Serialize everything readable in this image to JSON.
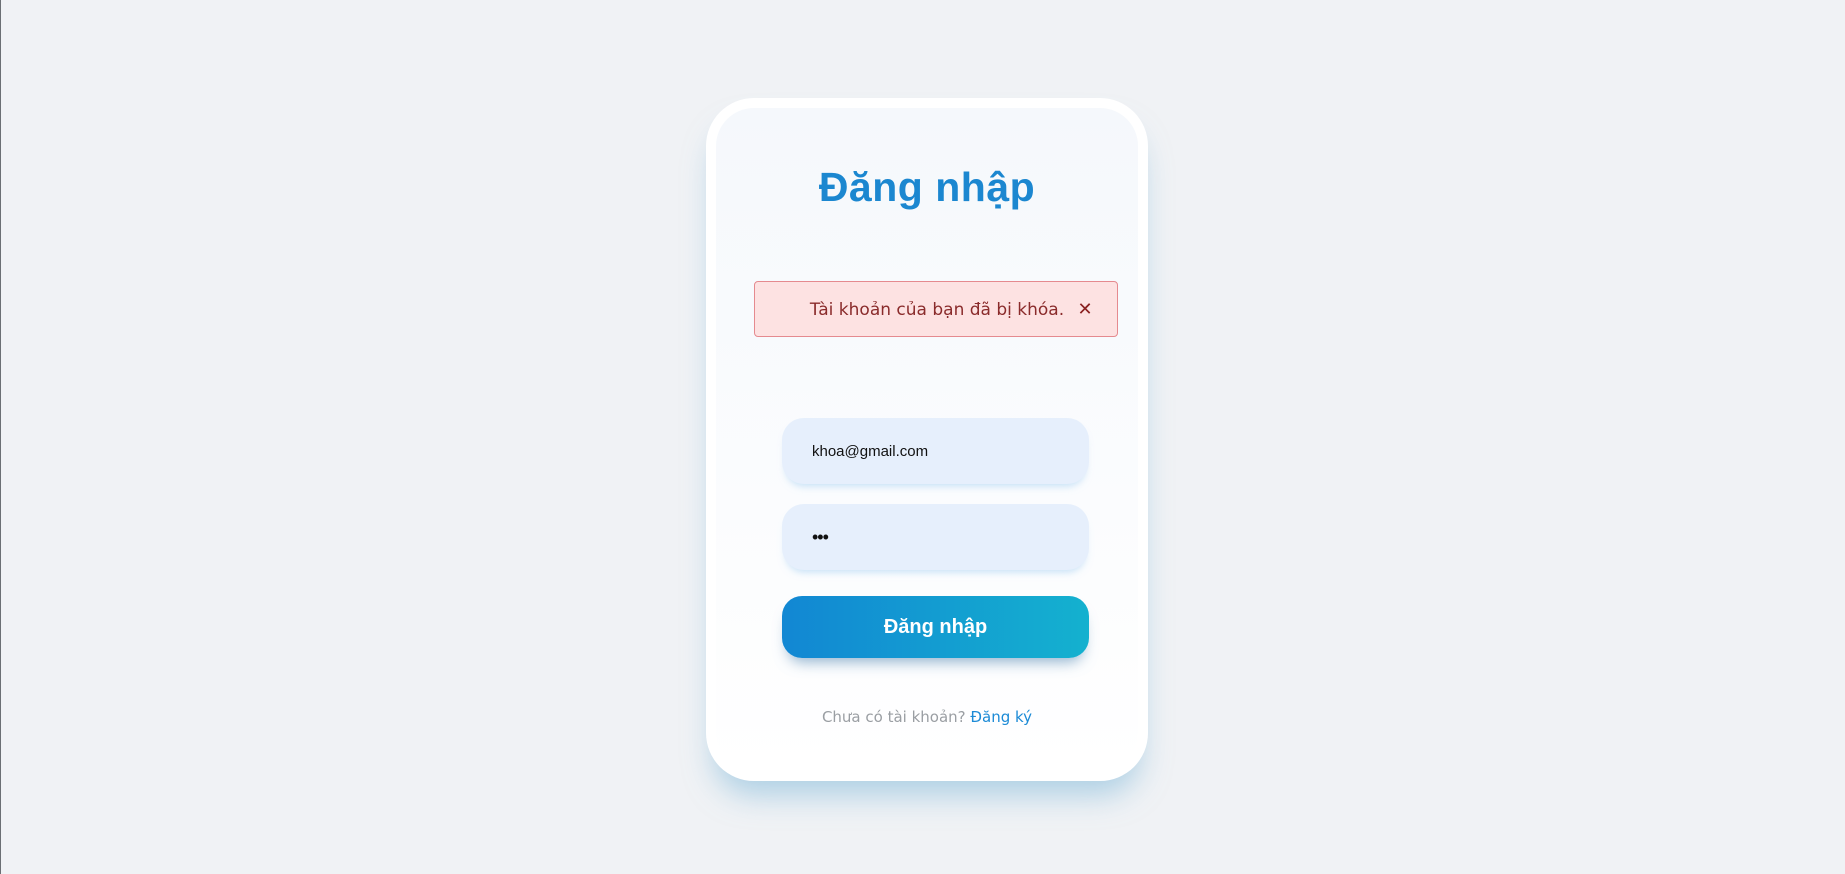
{
  "page": {
    "title": "Đăng nhập"
  },
  "alert": {
    "message": "Tài khoản của bạn đã bị khóa.",
    "close_glyph": "✕",
    "close_icon": "close-icon"
  },
  "form": {
    "email_value": "khoa@gmail.com",
    "password_value": "abc",
    "submit_label": "Đăng nhập"
  },
  "footer": {
    "prompt": "Chưa có tài khoản?",
    "signup_label": "Đăng ký"
  },
  "colors": {
    "background": "#f0f2f5",
    "accent": "#1b87d0",
    "button_start": "#1287d3",
    "button_end": "#14b1cf",
    "alert_bg": "#fde2e2",
    "alert_border": "#e58a8f",
    "alert_text": "#8a2b2b",
    "input_bg": "#e6effc"
  }
}
